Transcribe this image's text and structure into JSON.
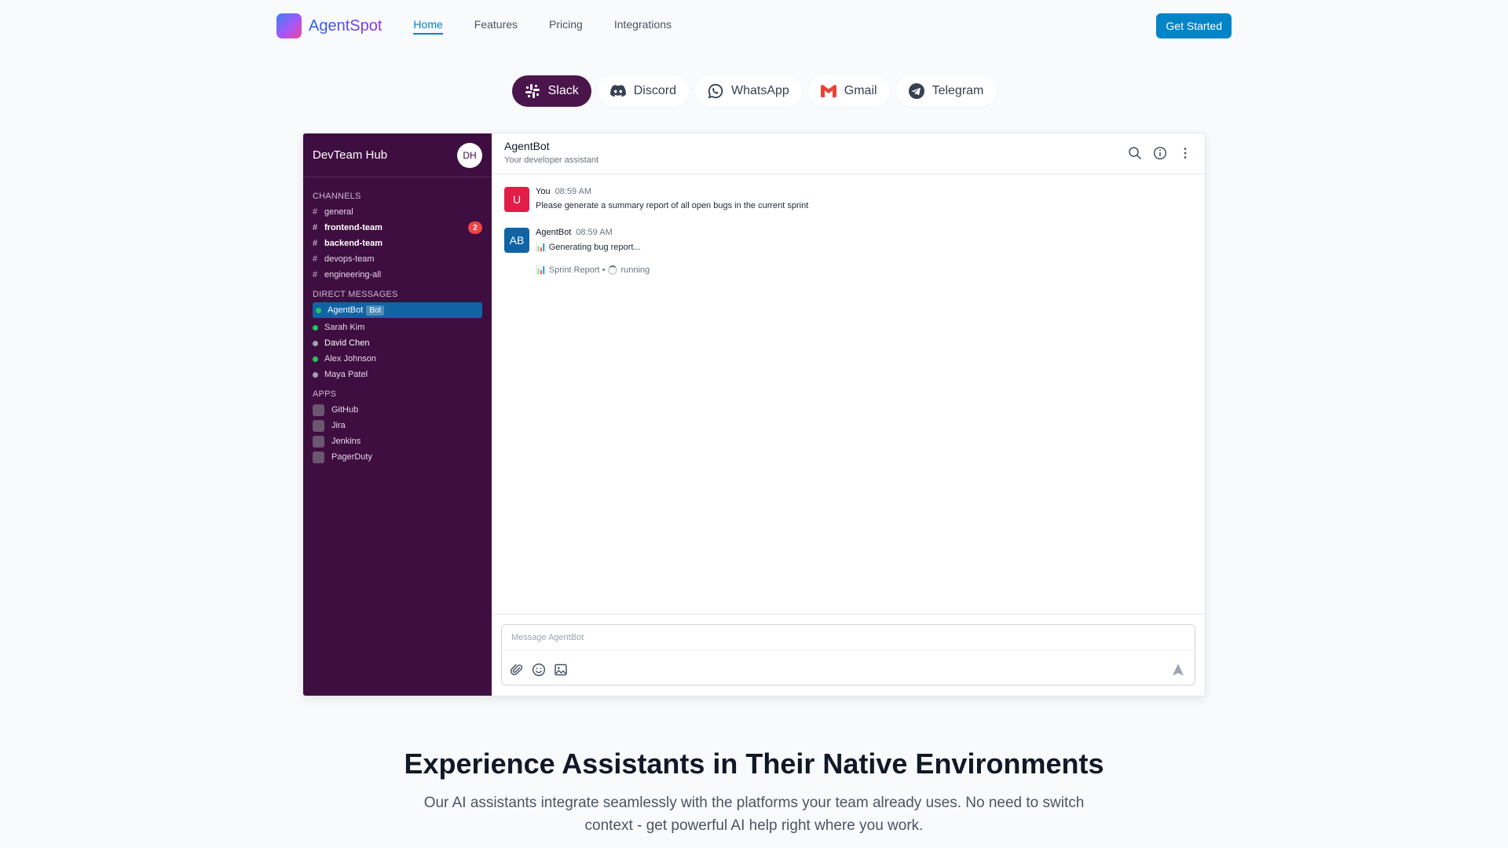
{
  "brand": {
    "name": "AgentSpot"
  },
  "nav": {
    "links": [
      {
        "label": "Home"
      },
      {
        "label": "Features"
      },
      {
        "label": "Pricing"
      },
      {
        "label": "Integrations"
      }
    ],
    "cta": "Get Started"
  },
  "platforms": [
    {
      "label": "Slack",
      "icon": "slack-icon",
      "active": true
    },
    {
      "label": "Discord",
      "icon": "discord-icon"
    },
    {
      "label": "WhatsApp",
      "icon": "whatsapp-icon"
    },
    {
      "label": "Gmail",
      "icon": "gmail-icon"
    },
    {
      "label": "Telegram",
      "icon": "telegram-icon"
    }
  ],
  "workspace": {
    "name": "DevTeam Hub",
    "avatar": "DH",
    "channels_title": "CHANNELS",
    "channels": [
      {
        "hash": "#",
        "name": "general"
      },
      {
        "hash": "#",
        "name": "frontend-team",
        "badge": "2"
      },
      {
        "hash": "#",
        "name": "backend-team"
      },
      {
        "hash": "#",
        "name": "devops-team"
      },
      {
        "hash": "#",
        "name": "engineering-all"
      }
    ],
    "dm_title": "DIRECT MESSAGES",
    "dms": [
      {
        "name": "AgentBot",
        "tag": "Bot"
      },
      {
        "name": "Sarah Kim"
      },
      {
        "name": "David Chen"
      },
      {
        "name": "Alex Johnson"
      },
      {
        "name": "Maya Patel"
      }
    ],
    "apps_title": "APPS",
    "apps": [
      {
        "name": "GitHub"
      },
      {
        "name": "Jira"
      },
      {
        "name": "Jenkins"
      },
      {
        "name": "PagerDuty"
      }
    ]
  },
  "chat": {
    "title": "AgentBot",
    "subtitle": "Your developer assistant",
    "messages": [
      {
        "avatar": "U",
        "author": "You",
        "time": "08:59 AM",
        "text": "Please generate a summary report of all open bugs in the current sprint"
      },
      {
        "avatar": "AB",
        "author": "AgentBot",
        "time": "08:59 AM",
        "text": "📊 Generating bug report...",
        "tool": "📊 Sprint Report •",
        "status": "running"
      }
    ],
    "placeholder": "Message AgentBot"
  },
  "hero": {
    "title": "Experience Assistants in Their Native Environments",
    "subtitle": "Our AI assistants integrate seamlessly with the platforms your team already uses. No need to switch context - get powerful AI help right where you work."
  }
}
